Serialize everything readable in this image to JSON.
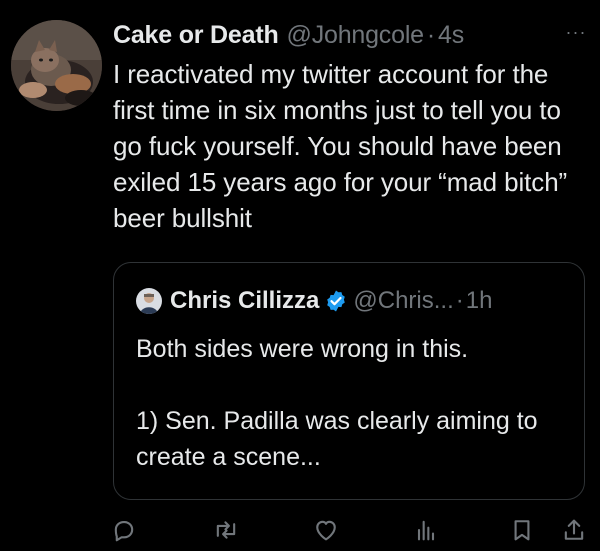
{
  "tweet": {
    "author": {
      "display_name": "Cake or Death",
      "handle": "@Johngcole",
      "avatar_icon": "cat-avatar"
    },
    "separator": "·",
    "time": "4s",
    "more_icon": "more-horizontal-icon",
    "more_label": "···",
    "text": "I reactivated my twitter account for the first time in six months just to tell you to go fuck yourself.  You should have been exiled 15 years ago for your “mad bitch” beer bullshit"
  },
  "quoted_tweet": {
    "author": {
      "display_name": "Chris Cillizza",
      "handle": "@Chris...",
      "verified": true,
      "avatar_icon": "person-avatar"
    },
    "separator": "·",
    "time": "1h",
    "text_line_1": "Both sides were wrong in this.",
    "text_line_2": "1) Sen. Padilla was clearly aiming to create a scene..."
  },
  "actions": [
    {
      "name": "reply",
      "icon": "reply-icon"
    },
    {
      "name": "retweet",
      "icon": "retweet-icon"
    },
    {
      "name": "like",
      "icon": "heart-icon"
    },
    {
      "name": "views",
      "icon": "analytics-icon"
    },
    {
      "name": "bookmark",
      "icon": "bookmark-icon"
    },
    {
      "name": "share",
      "icon": "share-icon"
    }
  ],
  "colors": {
    "background": "#000000",
    "text_primary": "#e7e9ea",
    "text_secondary": "#71767b",
    "border": "#2f3336",
    "verified_blue": "#1d9bf0"
  }
}
